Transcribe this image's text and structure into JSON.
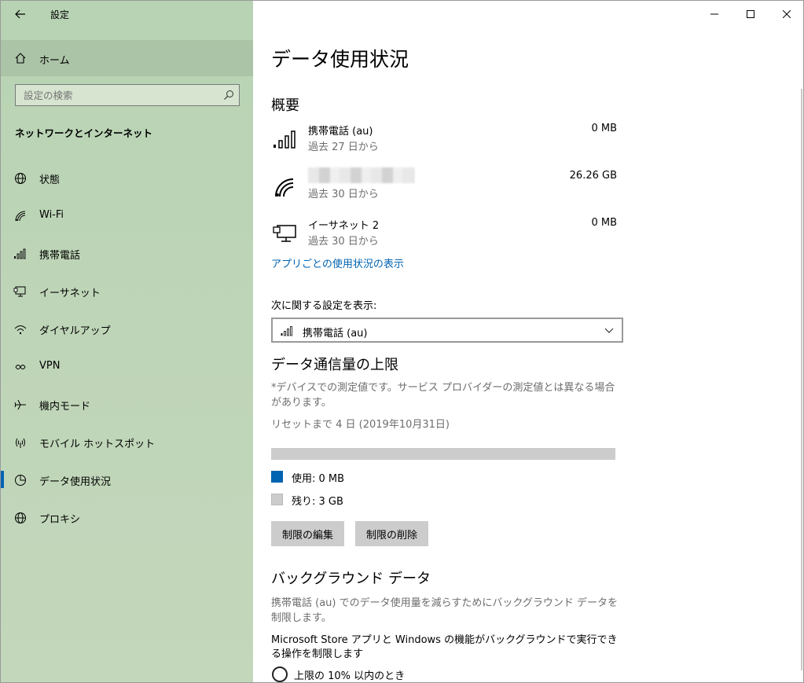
{
  "app": {
    "title": "設定"
  },
  "sidebar": {
    "home_label": "ホーム",
    "search_placeholder": "設定の検索",
    "section_title": "ネットワークとインターネット",
    "items": [
      {
        "label": "状態",
        "icon": "globe-status-icon"
      },
      {
        "label": "Wi-Fi",
        "icon": "wifi-icon"
      },
      {
        "label": "携帯電話",
        "icon": "cellular-icon"
      },
      {
        "label": "イーサネット",
        "icon": "ethernet-icon"
      },
      {
        "label": "ダイヤルアップ",
        "icon": "dialup-icon"
      },
      {
        "label": "VPN",
        "icon": "vpn-icon"
      },
      {
        "label": "機内モード",
        "icon": "airplane-icon"
      },
      {
        "label": "モバイル ホットスポット",
        "icon": "hotspot-icon"
      },
      {
        "label": "データ使用状況",
        "icon": "data-usage-icon",
        "active": true
      },
      {
        "label": "プロキシ",
        "icon": "globe-icon"
      }
    ]
  },
  "main": {
    "page_title": "データ使用状況",
    "overview": {
      "heading": "概要",
      "rows": [
        {
          "name": "携帯電話 (au)",
          "sub": "過去 27 日から",
          "amount": "0 MB"
        },
        {
          "name": "",
          "sub": "過去 30 日から",
          "amount": "26.26 GB"
        },
        {
          "name": "イーサネット 2",
          "sub": "過去 30 日から",
          "amount": "0 MB"
        }
      ],
      "app_usage_link": "アプリごとの使用状況の表示"
    },
    "settings_for": {
      "label": "次に関する設定を表示:",
      "selected": "携帯電話 (au)"
    },
    "data_limit": {
      "heading": "データ通信量の上限",
      "note": "*デバイスでの測定値です。サービス プロバイダーの測定値とは異なる場合があります。",
      "reset": "リセットまで 4 日 (2019年10月31日)",
      "used_fraction": 0.0,
      "used_label": "使用: 0 MB",
      "remaining_label": "残り: 3 GB",
      "used_color": "#0063b1",
      "remaining_color": "#cccccc",
      "edit_button": "制限の編集",
      "delete_button": "制限の削除"
    },
    "background": {
      "heading": "バックグラウンド データ",
      "note": "携帯電話 (au) でのデータ使用量を減らすためにバックグラウンド データを制限します。",
      "question": "Microsoft Store アプリと Windows の機能がバックグラウンドで実行できる操作を制限します",
      "option1": "上限の 10% 以内のとき"
    }
  }
}
